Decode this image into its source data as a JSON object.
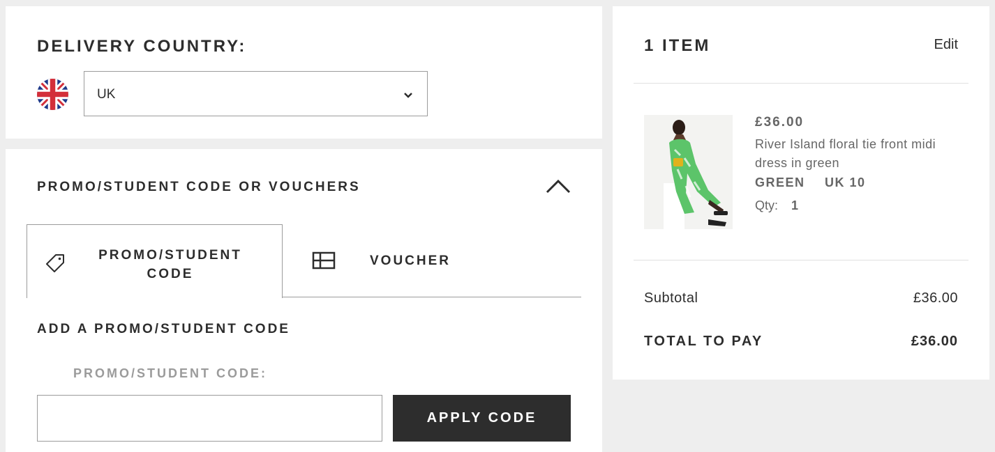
{
  "delivery": {
    "title": "DELIVERY COUNTRY:",
    "flag_icon": "uk-flag-icon",
    "country": "UK",
    "chevron_icon": "chevron-down-icon"
  },
  "promo": {
    "title": "PROMO/STUDENT CODE OR VOUCHERS",
    "toggle_icon": "chevron-up-icon",
    "tabs": [
      {
        "label": "PROMO/STUDENT CODE",
        "icon": "tag-icon",
        "active": true
      },
      {
        "label": "VOUCHER",
        "icon": "voucher-card-icon",
        "active": false
      }
    ],
    "add_title": "ADD A PROMO/STUDENT CODE",
    "field_label": "PROMO/STUDENT CODE:",
    "field_value": "",
    "field_placeholder": "",
    "apply_label": "APPLY CODE"
  },
  "summary": {
    "items_title": "1 ITEM",
    "edit_label": "Edit",
    "product": {
      "price": "£36.00",
      "name": "River Island floral tie front midi dress in green",
      "colour": "GREEN",
      "size": "UK 10",
      "qty_label": "Qty:",
      "qty": "1"
    },
    "subtotal_label": "Subtotal",
    "subtotal_value": "£36.00",
    "total_label": "TOTAL TO PAY",
    "total_value": "£36.00"
  },
  "colors": {
    "page_bg": "#eeeeee",
    "panel_bg": "#ffffff",
    "text": "#2d2d2d",
    "muted": "#9b9b9b",
    "button_bg": "#2d2d2d",
    "button_text": "#ffffff",
    "dress_green": "#5cc46a"
  }
}
